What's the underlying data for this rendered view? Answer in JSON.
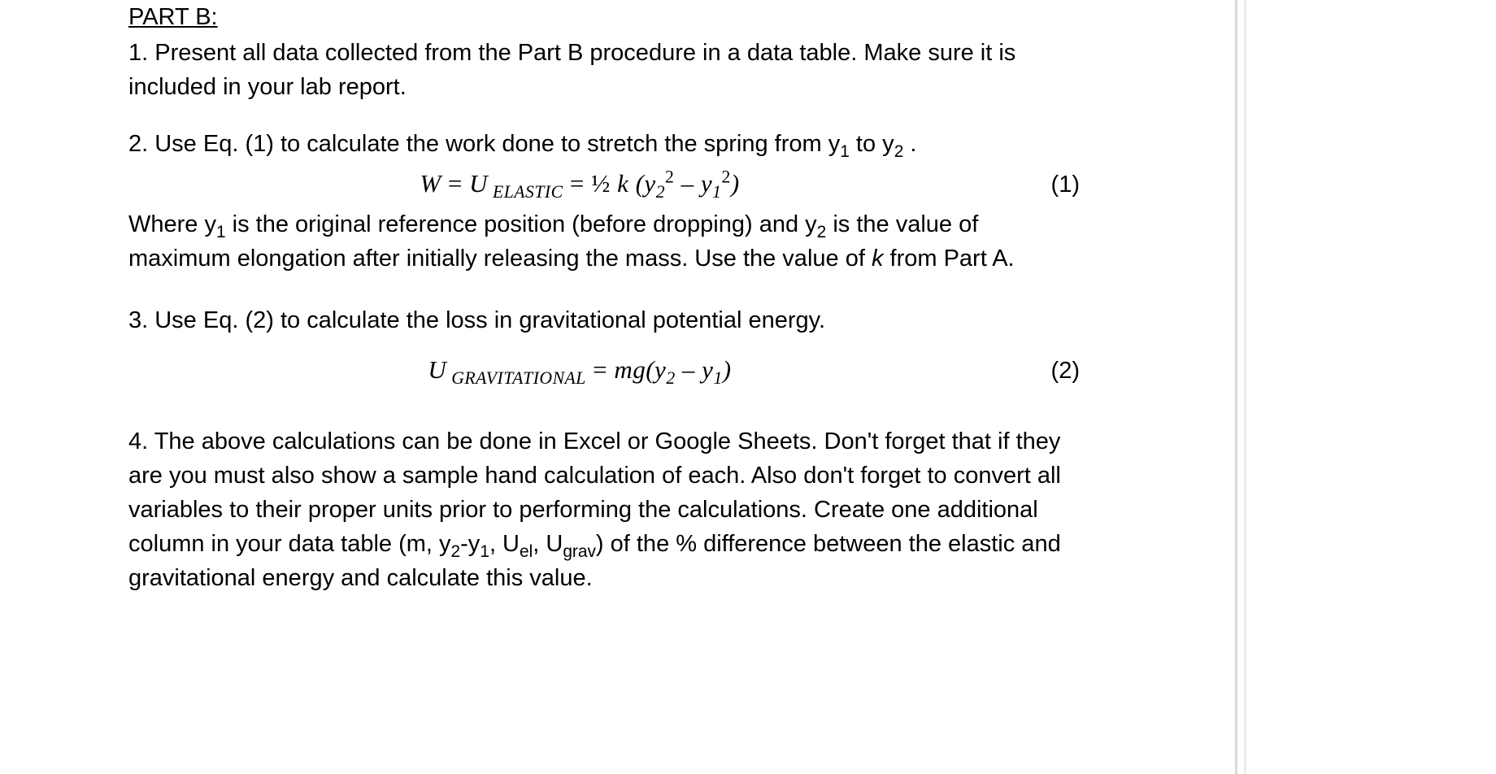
{
  "section_title": "PART B:",
  "item1": "1. Present all data collected from the Part B procedure in a data table.  Make sure it is included in your lab report.",
  "item2_intro": "2. Use Eq. (1) to calculate the work done to stretch the spring from y",
  "item2_mid": " to y",
  "item2_end": " .",
  "eq1_lhs_W": "W",
  "eq1_eq1": " = ",
  "eq1_U": "U",
  "eq1_elastic": " ELASTIC",
  "eq1_eq2": " = ",
  "eq1_half": "½ ",
  "eq1_k": "k ",
  "eq1_open": "(y",
  "eq1_minus": " – y",
  "eq1_close": ")",
  "eq1_label": "(1)",
  "item2_after_a": "Where y",
  "item2_after_b": " is the original reference position (before dropping) and y",
  "item2_after_c": " is the value of maximum elongation after initially releasing the mass.  Use the value of ",
  "item2_after_k": "k",
  "item2_after_d": " from Part A.",
  "item3": "3. Use Eq. (2) to calculate the loss in gravitational potential energy.",
  "eq2_U": "U",
  "eq2_grav": " GRAVITATIONAL",
  "eq2_eq": " = ",
  "eq2_mg": "mg(y",
  "eq2_minus": " – y",
  "eq2_close": ")",
  "eq2_label": "(2)",
  "item4_a": "4. The above calculations can be done in Excel or Google Sheets.  Don't forget that if they are you must also show a sample hand calculation of each.  Also don't forget to convert all variables to their proper units prior to performing the calculations.  Create one additional column in your data table (m, y",
  "item4_b": "-y",
  "item4_c": ", U",
  "item4_d": ", U",
  "item4_e": ") of the % difference between the elastic and gravitational energy and calculate this value.",
  "sub_1": "1",
  "sub_2": "2",
  "sub_el": "el",
  "sub_grav": "grav",
  "sup_2": "2"
}
